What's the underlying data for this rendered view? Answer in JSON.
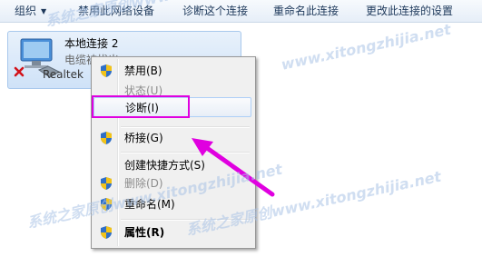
{
  "toolbar": {
    "organize": "组织",
    "disable": "禁用此网络设备",
    "diagnose": "诊断这个连接",
    "rename": "重命名此连接",
    "change_settings": "更改此连接的设置"
  },
  "connection": {
    "name": "本地连接 2",
    "status": "电缆被拔出",
    "device": "Realtek"
  },
  "menu": {
    "items": [
      {
        "label": "禁用(B)",
        "shield": true
      },
      {
        "label": "状态(U)",
        "disabled": true
      },
      {
        "label": "诊断(I)"
      },
      {
        "label": "桥接(G)",
        "shield": true
      },
      {
        "label": "创建快捷方式(S)"
      },
      {
        "label": "删除(D)",
        "shield": true,
        "disabled": true
      },
      {
        "label": "重命名(M)",
        "shield": true
      },
      {
        "label": "属性(R)",
        "shield": true,
        "bold": true
      }
    ]
  },
  "watermark": {
    "line1": "系统之家原创www.xitongzhijia.net",
    "line2": "www.xitongzhijia.net",
    "line3": "系统之家原创www.xitongzhijia.net",
    "line4": "系统之家原创www.xitongzhijia.net"
  },
  "colors": {
    "highlight": "#e000e0",
    "arrow": "#e000e0"
  }
}
